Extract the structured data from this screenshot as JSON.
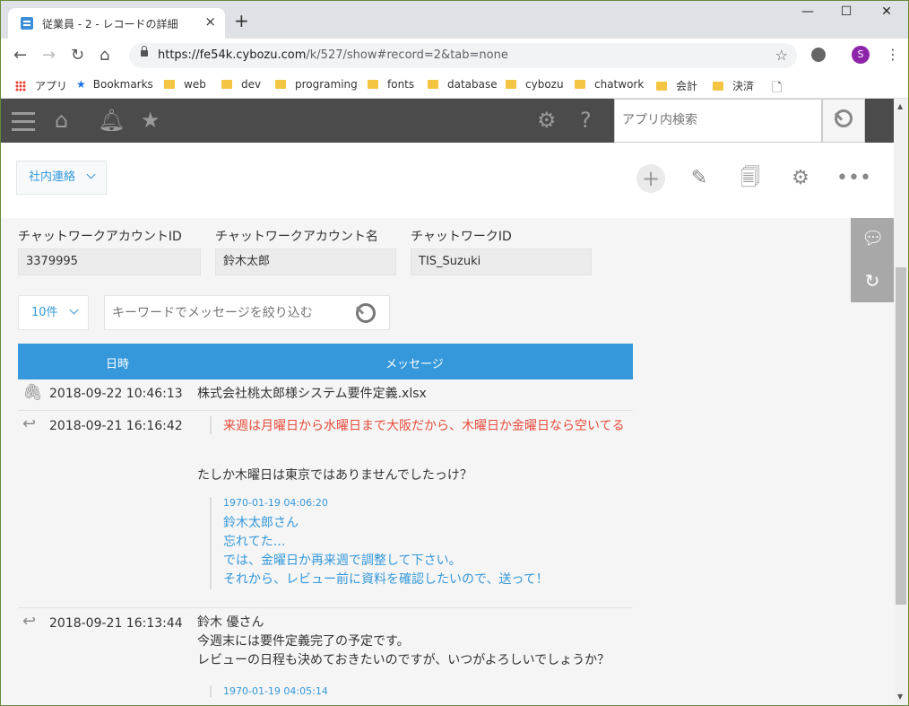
{
  "browser": {
    "tab_title": "従業員 - 2 - レコードの詳細",
    "tab_close": "×",
    "new_tab": "+",
    "minimize": "—",
    "maximize": "☐",
    "close": "✕",
    "url_main": "https://fe54k.cybozu.com",
    "url_rest": "/k/527/show#record=2&tab=none",
    "profile_initial": "S"
  },
  "bookmarks": [
    {
      "label": "アプリ",
      "icon": "apps-grid-icon"
    },
    {
      "label": "Bookmarks",
      "icon": "star-icon"
    },
    {
      "label": "web",
      "icon": "folder-icon"
    },
    {
      "label": "dev",
      "icon": "folder-icon"
    },
    {
      "label": "programing",
      "icon": "folder-icon"
    },
    {
      "label": "fonts",
      "icon": "folder-icon"
    },
    {
      "label": "database",
      "icon": "folder-icon"
    },
    {
      "label": "cybozu",
      "icon": "folder-icon"
    },
    {
      "label": "chatwork",
      "icon": "folder-icon"
    },
    {
      "label": "会計",
      "icon": "folder-icon"
    },
    {
      "label": "決済",
      "icon": "folder-icon"
    }
  ],
  "header": {
    "search_placeholder": "アプリ内検索"
  },
  "toolbar": {
    "space_dropdown": "社内連絡"
  },
  "fields": [
    {
      "label": "チャットワークアカウントID",
      "value": "3379995"
    },
    {
      "label": "チャットワークアカウント名",
      "value": "鈴木太郎"
    },
    {
      "label": "チャットワークID",
      "value": "TIS_Suzuki"
    }
  ],
  "filter": {
    "count_dropdown": "10件",
    "keyword_placeholder": "キーワードでメッセージを絞り込む"
  },
  "table": {
    "headers": [
      "日時",
      "メッセージ"
    ],
    "rows": [
      {
        "icon": "attachment-icon",
        "datetime": "2018-09-22 10:46:13",
        "message": "株式会社桃太郎様システム要件定義.xlsx"
      },
      {
        "icon": "reply-icon",
        "datetime": "2018-09-21 16:16:42",
        "quote_red": "来週は月曜日から水曜日まで大阪だから、木曜日か金曜日なら空いてる",
        "message": "たしか木曜日は東京ではありませんでしたっけ？",
        "quote_stamp": "1970-01-19 04:06:20",
        "quote_lines": [
          "鈴木太郎さん",
          "忘れてた…",
          "では、金曜日か再来週で調整して下さい。",
          "それから、レビュー前に資料を確認したいので、送って！"
        ]
      },
      {
        "icon": "reply-icon",
        "datetime": "2018-09-21 16:13:44",
        "message_lines": [
          "鈴木 優さん",
          "今週末には要件定義完了の予定です。",
          "レビューの日程も決めておきたいのですが、いつがよろしいでしょうか？"
        ],
        "quote_stamp": "1970-01-19 04:05:14"
      }
    ]
  },
  "colors": {
    "accent": "#3498db",
    "header_bg": "#4b4b4b",
    "quote_red": "#e74c3c"
  }
}
